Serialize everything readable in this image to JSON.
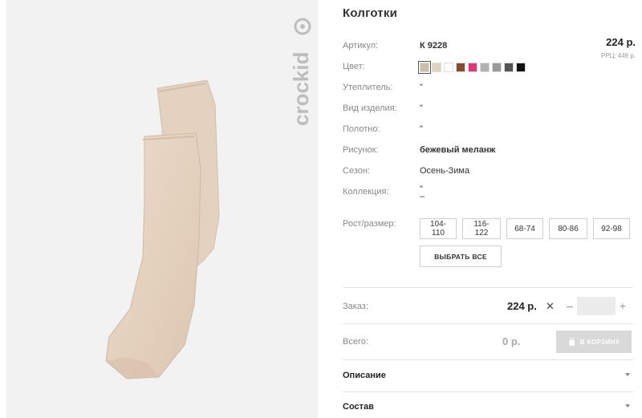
{
  "product": {
    "title": "Колготки",
    "brand_logo_text": "crockid",
    "brand_logo_icon": "smile-circle-icon",
    "image_alt": "бежевые колготки"
  },
  "details": {
    "article_label": "Артикул:",
    "article_value": "К 9228",
    "color_label": "Цвет:",
    "insulation_label": "Утеплитель:",
    "insulation_value": "\"",
    "type_label": "Вид изделия:",
    "type_value": "\"",
    "fabric_label": "Полотно:",
    "fabric_value": "\"",
    "pattern_label": "Рисунок:",
    "pattern_value": "бежевый меланж",
    "season_label": "Сезон:",
    "season_value": "Осень-Зима",
    "collection_label": "Коллекция:",
    "collection_value_line1": "\"",
    "collection_value_line2": "–",
    "size_label": "Рост/размер:"
  },
  "price": {
    "value": "224 р.",
    "rrp_label": "РРЦ:",
    "rrp_value": "449 р."
  },
  "colors": [
    {
      "hex": "#cdbfa6",
      "selected": true
    },
    {
      "hex": "#e0d4bc",
      "selected": false
    },
    {
      "hex": "#ffffff",
      "selected": false
    },
    {
      "hex": "#8b4a2b",
      "selected": false
    },
    {
      "hex": "#e3337a",
      "selected": false
    },
    {
      "hex": "#b1b1b1",
      "selected": false
    },
    {
      "hex": "#9a9a9a",
      "selected": false
    },
    {
      "hex": "#555555",
      "selected": false
    },
    {
      "hex": "#111111",
      "selected": false
    }
  ],
  "sizes": [
    "104-110",
    "116-122",
    "68-74",
    "80-86",
    "92-98"
  ],
  "select_all_label": "ВЫБРАТЬ ВСЕ",
  "order": {
    "label": "Заказ:",
    "price": "224 р.",
    "times_symbol": "✕",
    "minus_symbol": "–",
    "plus_symbol": "+",
    "quantity_value": ""
  },
  "total": {
    "label": "Всего:",
    "value": "0 р.",
    "cart_button_label": "В КОРЗИНУ",
    "cart_icon": "shopping-bag-icon"
  },
  "accordion": {
    "description_label": "Описание",
    "composition_label": "Состав"
  }
}
